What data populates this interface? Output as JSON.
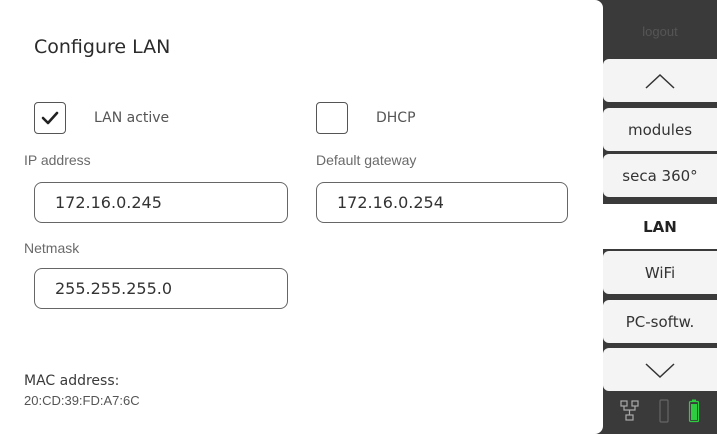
{
  "form": {
    "title": "Configure LAN",
    "lan_active": {
      "label": "LAN active",
      "checked": true
    },
    "dhcp": {
      "label": "DHCP",
      "checked": false
    },
    "ip_address": {
      "label": "IP address",
      "value": "172.16.0.245"
    },
    "default_gateway": {
      "label": "Default gateway",
      "value": "172.16.0.254"
    },
    "netmask": {
      "label": "Netmask",
      "value": "255.255.255.0"
    },
    "mac": {
      "label": "MAC address:",
      "value": "20:CD:39:FD:A7:6C"
    }
  },
  "sidebar": {
    "logout_label": "logout",
    "items": [
      {
        "label": "modules"
      },
      {
        "label": "seca 360°"
      },
      {
        "label": "LAN",
        "active": true
      },
      {
        "label": "WiFi"
      },
      {
        "label": "PC-softw."
      }
    ],
    "status_icons": [
      "network-icon",
      "cradle-icon",
      "battery-icon"
    ]
  },
  "colors": {
    "panel": "#ffffff",
    "sidebar": "#3a3a3a",
    "battery": "#2ecc40"
  }
}
